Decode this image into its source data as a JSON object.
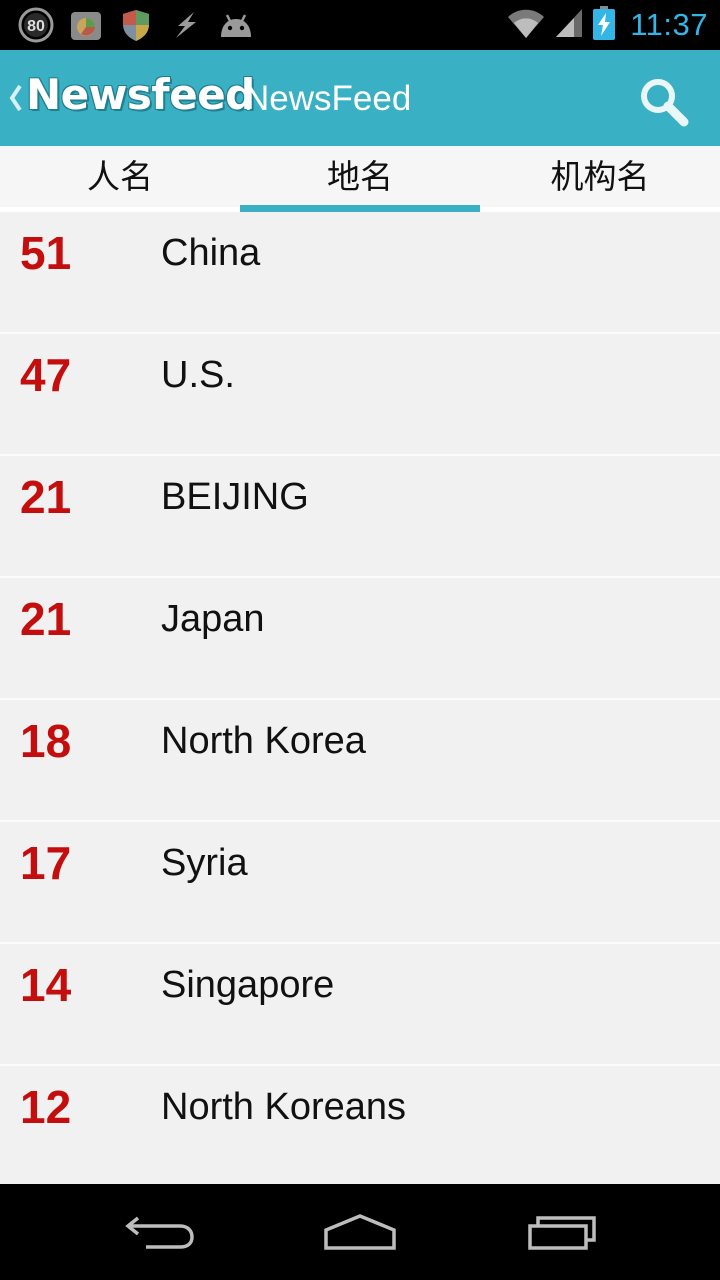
{
  "status_bar": {
    "notification_badge": "80",
    "time": "11:37",
    "icons": [
      "badge-80-icon",
      "app-icon",
      "shield-icon",
      "flash-icon",
      "android-icon",
      "wifi-icon",
      "signal-icon",
      "battery-charging-icon"
    ]
  },
  "action_bar": {
    "logo_text": "Newsfeed",
    "title": "NewsFeed",
    "icons": [
      "back-chevron-icon",
      "search-icon"
    ]
  },
  "tabs": [
    {
      "label": "人名",
      "selected": false
    },
    {
      "label": "地名",
      "selected": true
    },
    {
      "label": "机构名",
      "selected": false
    }
  ],
  "list": {
    "items": [
      {
        "count": "51",
        "name": "China"
      },
      {
        "count": "47",
        "name": "U.S."
      },
      {
        "count": "21",
        "name": "BEIJING"
      },
      {
        "count": "21",
        "name": "Japan"
      },
      {
        "count": "18",
        "name": "North Korea"
      },
      {
        "count": "17",
        "name": "Syria"
      },
      {
        "count": "14",
        "name": "Singapore"
      },
      {
        "count": "12",
        "name": "North Koreans"
      }
    ]
  },
  "nav_bar": {
    "icons": [
      "back-icon",
      "home-icon",
      "recent-apps-icon"
    ]
  },
  "colors": {
    "accent": "#39b0c3",
    "count_red": "#c40d0d",
    "clock_blue": "#33b5e5",
    "list_bg": "#f1f1f1"
  }
}
